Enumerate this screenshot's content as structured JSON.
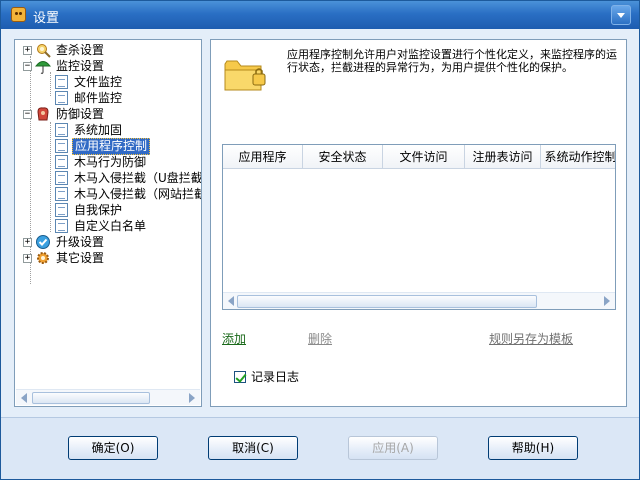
{
  "window": {
    "title": "设置"
  },
  "tree": {
    "items": [
      {
        "label": "查杀设置",
        "icon": "scan-settings-icon"
      },
      {
        "label": "监控设置",
        "icon": "umbrella-icon"
      },
      {
        "label": "文件监控",
        "icon": "document-icon"
      },
      {
        "label": "邮件监控",
        "icon": "document-icon"
      },
      {
        "label": "防御设置",
        "icon": "defense-glove-icon"
      },
      {
        "label": "系统加固",
        "icon": "document-icon"
      },
      {
        "label": "应用程序控制",
        "icon": "document-icon"
      },
      {
        "label": "木马行为防御",
        "icon": "document-icon"
      },
      {
        "label": "木马入侵拦截（U盘拦截",
        "icon": "document-icon"
      },
      {
        "label": "木马入侵拦截（网站拦截",
        "icon": "document-icon"
      },
      {
        "label": "自我保护",
        "icon": "document-icon"
      },
      {
        "label": "自定义白名单",
        "icon": "document-icon"
      },
      {
        "label": "升级设置",
        "icon": "check-globe-icon"
      },
      {
        "label": "其它设置",
        "icon": "settings-gear-icon"
      }
    ],
    "selected": "应用程序控制"
  },
  "main": {
    "description": "应用程序控制允许用户对监控设置进行个性化定义，来监控程序的运行状态，拦截进程的异常行为，为用户提供个性化的保护。",
    "columns": [
      "应用程序",
      "安全状态",
      "文件访问",
      "注册表访问",
      "系统动作控制"
    ],
    "links": {
      "add": "添加",
      "delete": "删除",
      "save_template": "规则另存为模板"
    },
    "log_checkbox": {
      "label": "记录日志",
      "checked": true
    }
  },
  "buttons": {
    "ok": "确定(O)",
    "cancel": "取消(C)",
    "apply": "应用(A)",
    "help": "帮助(H)"
  },
  "colors": {
    "titlebar": "#2a6fc4",
    "selection": "#316ac5",
    "add_link": "#1b6a1b"
  }
}
